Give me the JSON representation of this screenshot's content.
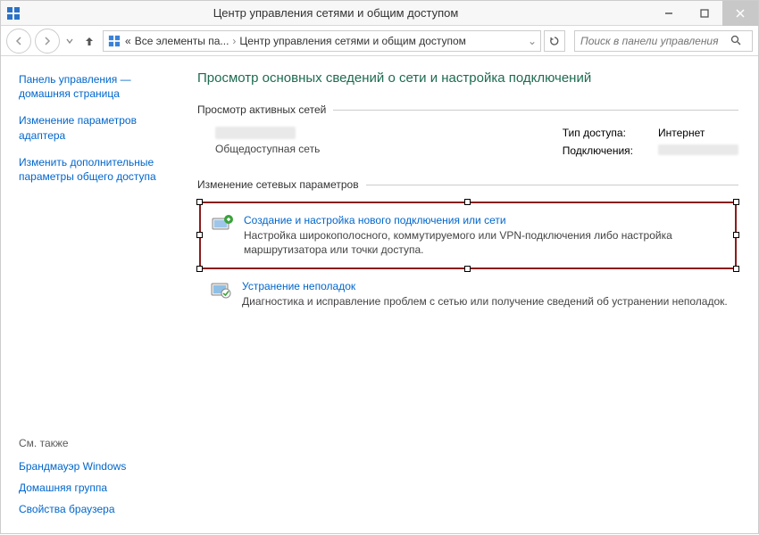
{
  "window": {
    "title": "Центр управления сетями и общим доступом"
  },
  "toolbar": {
    "breadcrumb_prefix": "«",
    "breadcrumb1": "Все элементы па...",
    "breadcrumb2": "Центр управления сетями и общим доступом",
    "search_placeholder": "Поиск в панели управления"
  },
  "sidebar": {
    "home": "Панель управления — домашняя страница",
    "adapter": "Изменение параметров адаптера",
    "sharing": "Изменить дополнительные параметры общего доступа",
    "see_also_hdr": "См. также",
    "firewall": "Брандмауэр Windows",
    "homegroup": "Домашняя группа",
    "browser": "Свойства браузера"
  },
  "main": {
    "heading": "Просмотр основных сведений о сети и настройка подключений",
    "active_hdr": "Просмотр активных сетей",
    "net_type": "Общедоступная сеть",
    "access_label": "Тип доступа:",
    "access_value": "Интернет",
    "conn_label": "Подключения:",
    "settings_hdr": "Изменение сетевых параметров",
    "opt1_title": "Создание и настройка нового подключения или сети",
    "opt1_desc": "Настройка широкополосного, коммутируемого или VPN-подключения либо настройка маршрутизатора или точки доступа.",
    "opt2_title": "Устранение неполадок",
    "opt2_desc": "Диагностика и исправление проблем с сетью или получение сведений об устранении неполадок."
  }
}
